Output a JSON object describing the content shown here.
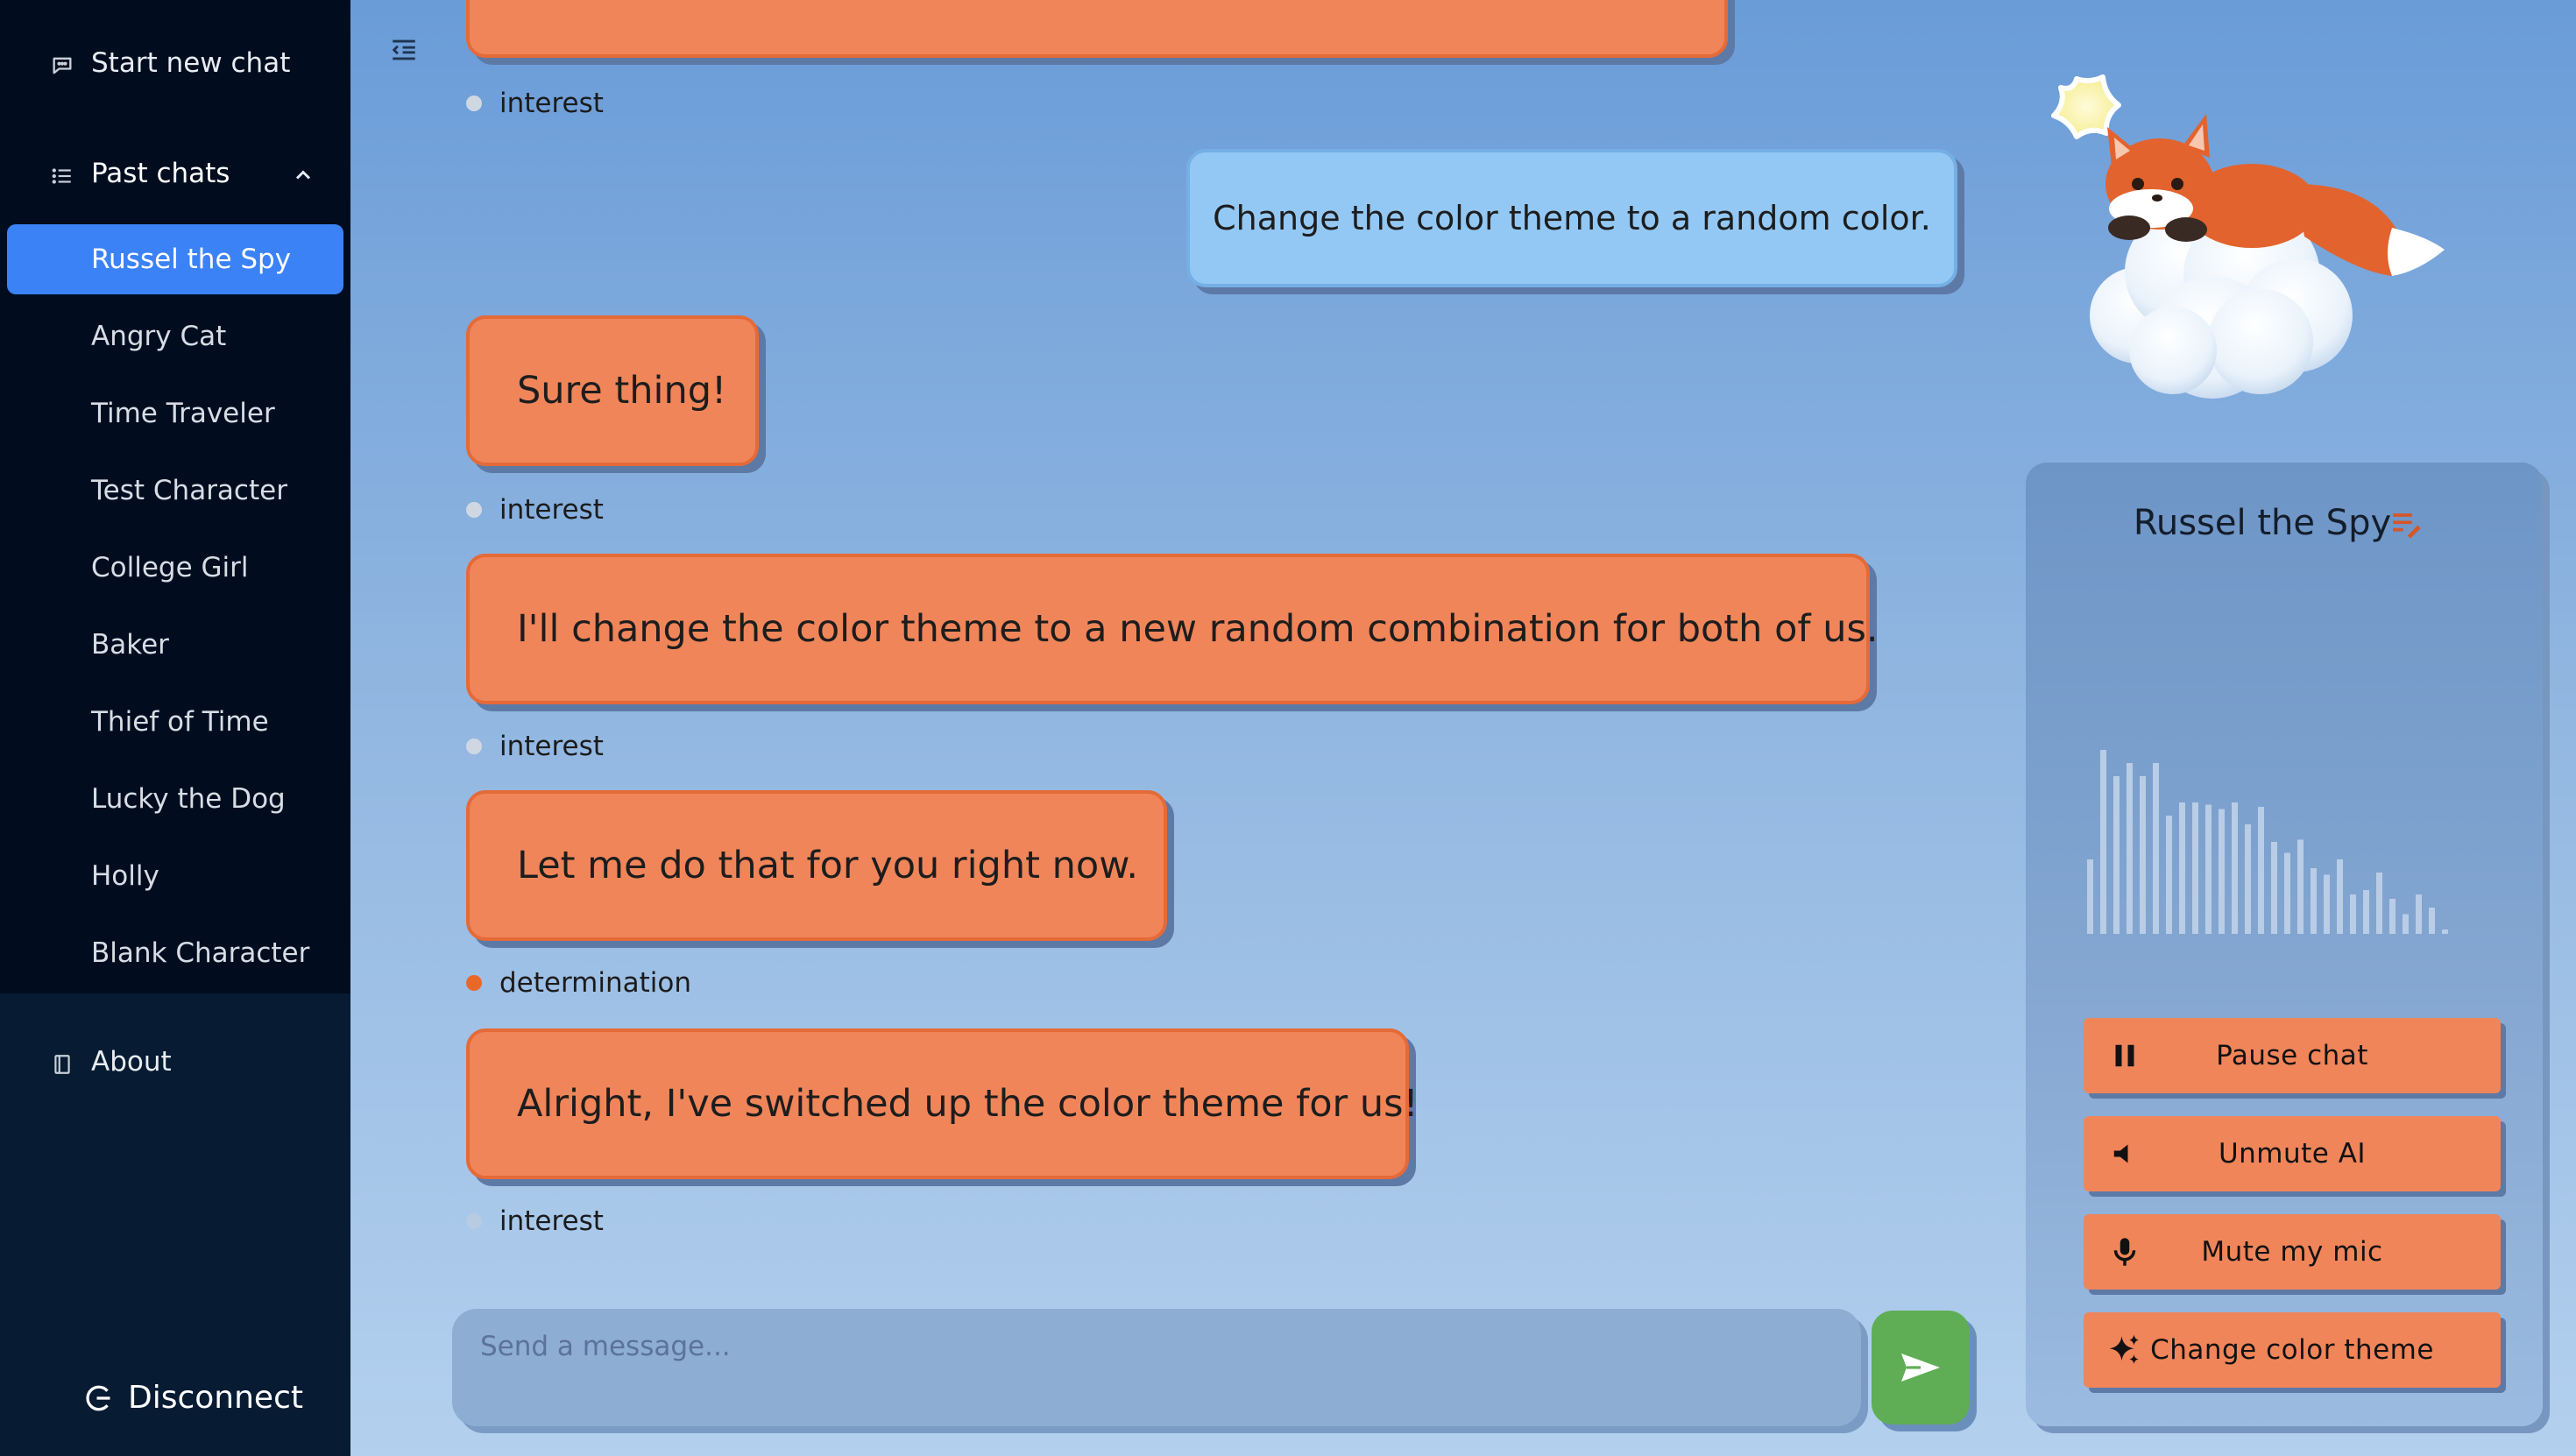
{
  "sidebar": {
    "start_new_chat": "Start new chat",
    "past_chats": "Past chats",
    "chats": [
      "Russel the Spy",
      "Angry Cat",
      "Time Traveler",
      "Test Character",
      "College Girl",
      "Baker",
      "Thief of Time",
      "Lucky the Dog",
      "Holly",
      "Blank Character"
    ],
    "active_chat": "Russel the Spy",
    "about": "About",
    "disconnect": "Disconnect"
  },
  "messages": [
    {
      "role": "assistant",
      "text": "",
      "emotion": "interest",
      "emotion_color": "#cfd8e2"
    },
    {
      "role": "user",
      "text": "Change the color theme to a random color."
    },
    {
      "role": "assistant",
      "text": "Sure thing!",
      "emotion": "interest",
      "emotion_color": "#cfd8e2"
    },
    {
      "role": "assistant",
      "text": "I'll change the color theme to a new random combination for both of us.",
      "emotion": "interest",
      "emotion_color": "#cfd8e2"
    },
    {
      "role": "assistant",
      "text": "Let me do that for you right now.",
      "emotion": "determination",
      "emotion_color": "#e8682a"
    },
    {
      "role": "assistant",
      "text": "Alright, I've switched up the color theme for us!",
      "emotion": "interest",
      "emotion_color": "#b8cbe0"
    }
  ],
  "input": {
    "placeholder": "Send a message...",
    "value": ""
  },
  "panel": {
    "character_name": "Russel the Spy",
    "buttons": {
      "pause": "Pause chat",
      "unmute": "Unmute AI",
      "mute_mic": "Mute my mic",
      "change_theme": "Change color theme"
    }
  },
  "icons": {
    "start_new_chat": "chat-bubble-icon",
    "past_chats": "list-icon",
    "about": "book-icon",
    "disconnect": "logout-icon",
    "sidebar_toggle": "indent-icon",
    "send": "send-icon",
    "edit": "edit-list-icon",
    "pause": "pause-icon",
    "unmute": "speaker-icon",
    "mute_mic": "microphone-icon",
    "change_theme": "sparkles-icon"
  },
  "colors": {
    "accent": "#f0855a",
    "active": "#3b82f6",
    "send": "#5fae55",
    "sidebar": "#010d1f"
  },
  "audio_levels": [
    0.34,
    0.84,
    0.72,
    0.78,
    0.72,
    0.78,
    0.54,
    0.6,
    0.6,
    0.59,
    0.57,
    0.6,
    0.5,
    0.58,
    0.42,
    0.37,
    0.43,
    0.3,
    0.27,
    0.34,
    0.18,
    0.2,
    0.28,
    0.16,
    0.09,
    0.18,
    0.12,
    0.02
  ]
}
